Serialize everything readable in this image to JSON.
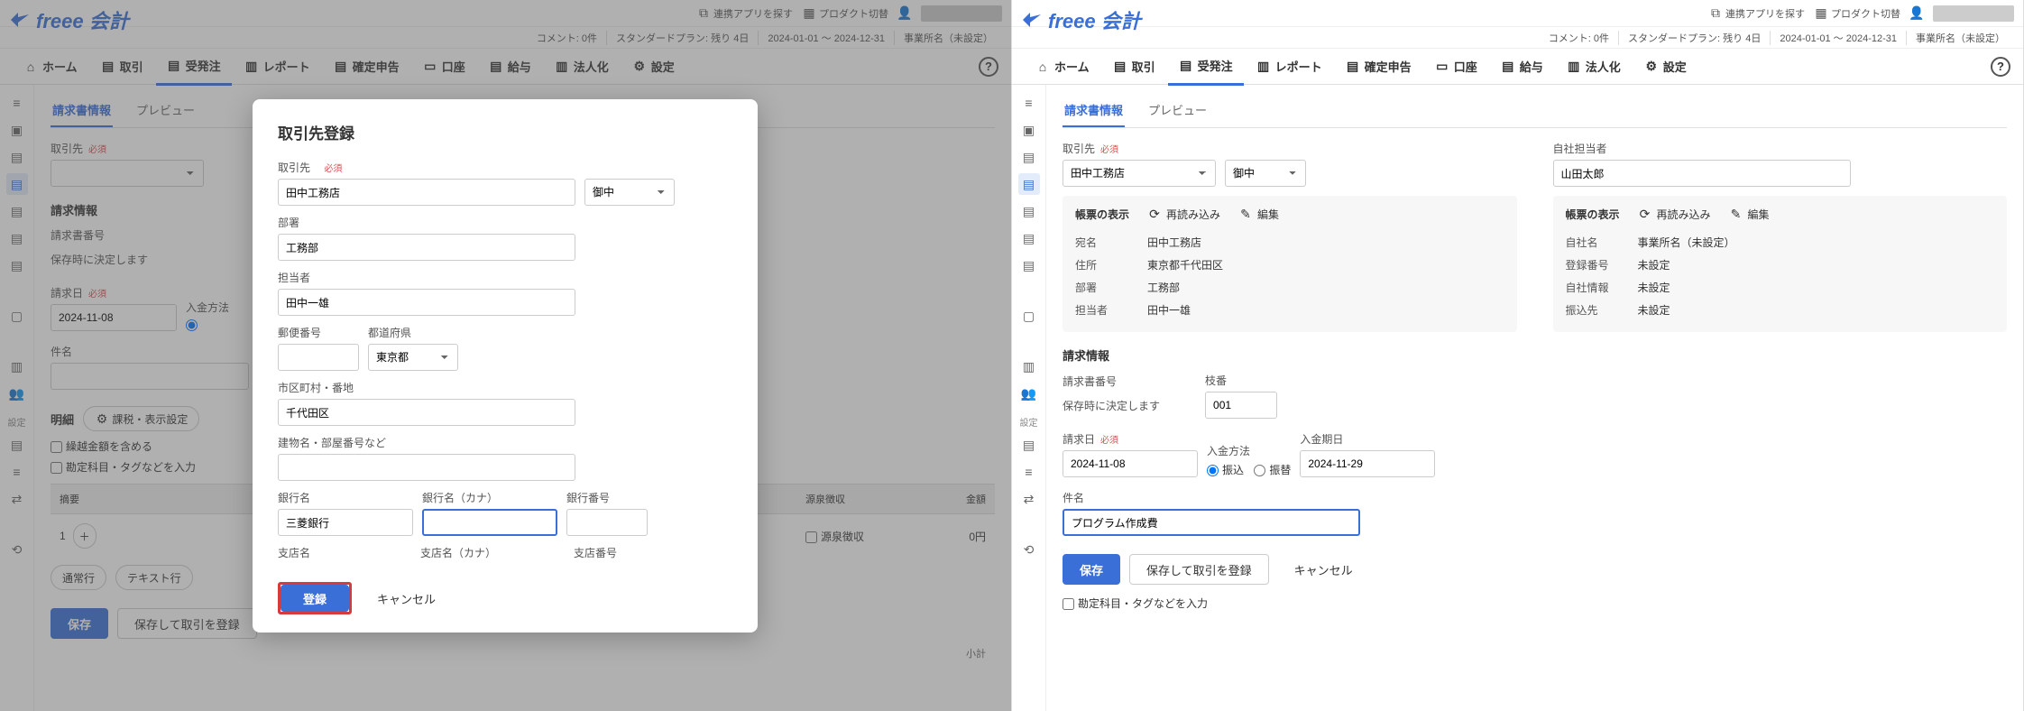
{
  "top": {
    "app_search": "連携アプリを探す",
    "product_switch": "プロダクト切替"
  },
  "sub": {
    "comments": "コメント: 0件",
    "plan": "スタンダードプラン: 残り 4日",
    "period": "2024-01-01 〜 2024-12-31",
    "office": "事業所名（未設定）"
  },
  "logo": "freee 会計",
  "nav": {
    "home": "ホーム",
    "transactions": "取引",
    "orders": "受発注",
    "reports": "レポート",
    "tax": "確定申告",
    "accounts": "口座",
    "salary": "給与",
    "corp": "法人化",
    "settings": "設定"
  },
  "sidebar_label": "設定",
  "tabs": {
    "invoice": "請求書情報",
    "preview": "プレビュー"
  },
  "labels": {
    "partner": "取引先",
    "dept": "部署",
    "contact": "担当者",
    "zip": "郵便番号",
    "pref": "都道府県",
    "city": "市区町村・番地",
    "building": "建物名・部屋番号など",
    "bank": "銀行名",
    "bank_kana": "銀行名（カナ）",
    "bank_code": "銀行番号",
    "branch": "支店名",
    "branch_kana": "支店名（カナ）",
    "branch_code": "支店番号",
    "required": "必須",
    "invoice_info": "請求情報",
    "invoice_no": "請求書番号",
    "invoice_auto": "保存時に決定します",
    "branch_no": "枝番",
    "invoice_date": "請求日",
    "pay_method": "入金方法",
    "pay_date": "入金期日",
    "subject": "件名",
    "detail": "明細",
    "detail_settings": "課税・表示設定",
    "carryover": "繰越金額を含める",
    "account_tags": "勘定科目・タグなどを入力",
    "summary": "摘要",
    "withholding": "源泉徴収",
    "amount": "金額",
    "zero": "0円",
    "subtotal": "小計",
    "normal_line": "通常行",
    "text_line": "テキスト行",
    "own_contact": "自社担当者",
    "voucher": "帳票の表示",
    "reload": "再読み込み",
    "edit": "編集",
    "dest_name": "宛名",
    "address": "住所",
    "own_name": "自社名",
    "reg_no": "登録番号",
    "own_info": "自社情報",
    "transfer_to": "振込先",
    "notset": "未設定",
    "suffix": "御中",
    "radio_transfer": "振込",
    "radio_swap": "振替",
    "save": "保存",
    "save_create": "保存して取引を登録",
    "cancel": "キャンセル",
    "register": "登録"
  },
  "modal": {
    "title": "取引先登録",
    "partner": "田中工務店",
    "dept": "工務部",
    "contact": "田中一雄",
    "pref": "東京都",
    "city": "千代田区",
    "bank": "三菱銀行"
  },
  "right": {
    "partner": "田中工務店",
    "own_contact": "山田太郎",
    "dest_name": "田中工務店",
    "address": "東京都千代田区",
    "dept": "工務部",
    "contact": "田中一雄",
    "own_name": "事業所名（未設定）",
    "invoice_date": "2024-11-08",
    "branch_no": "001",
    "pay_date": "2024-11-29",
    "subject": "プログラム作成費"
  }
}
